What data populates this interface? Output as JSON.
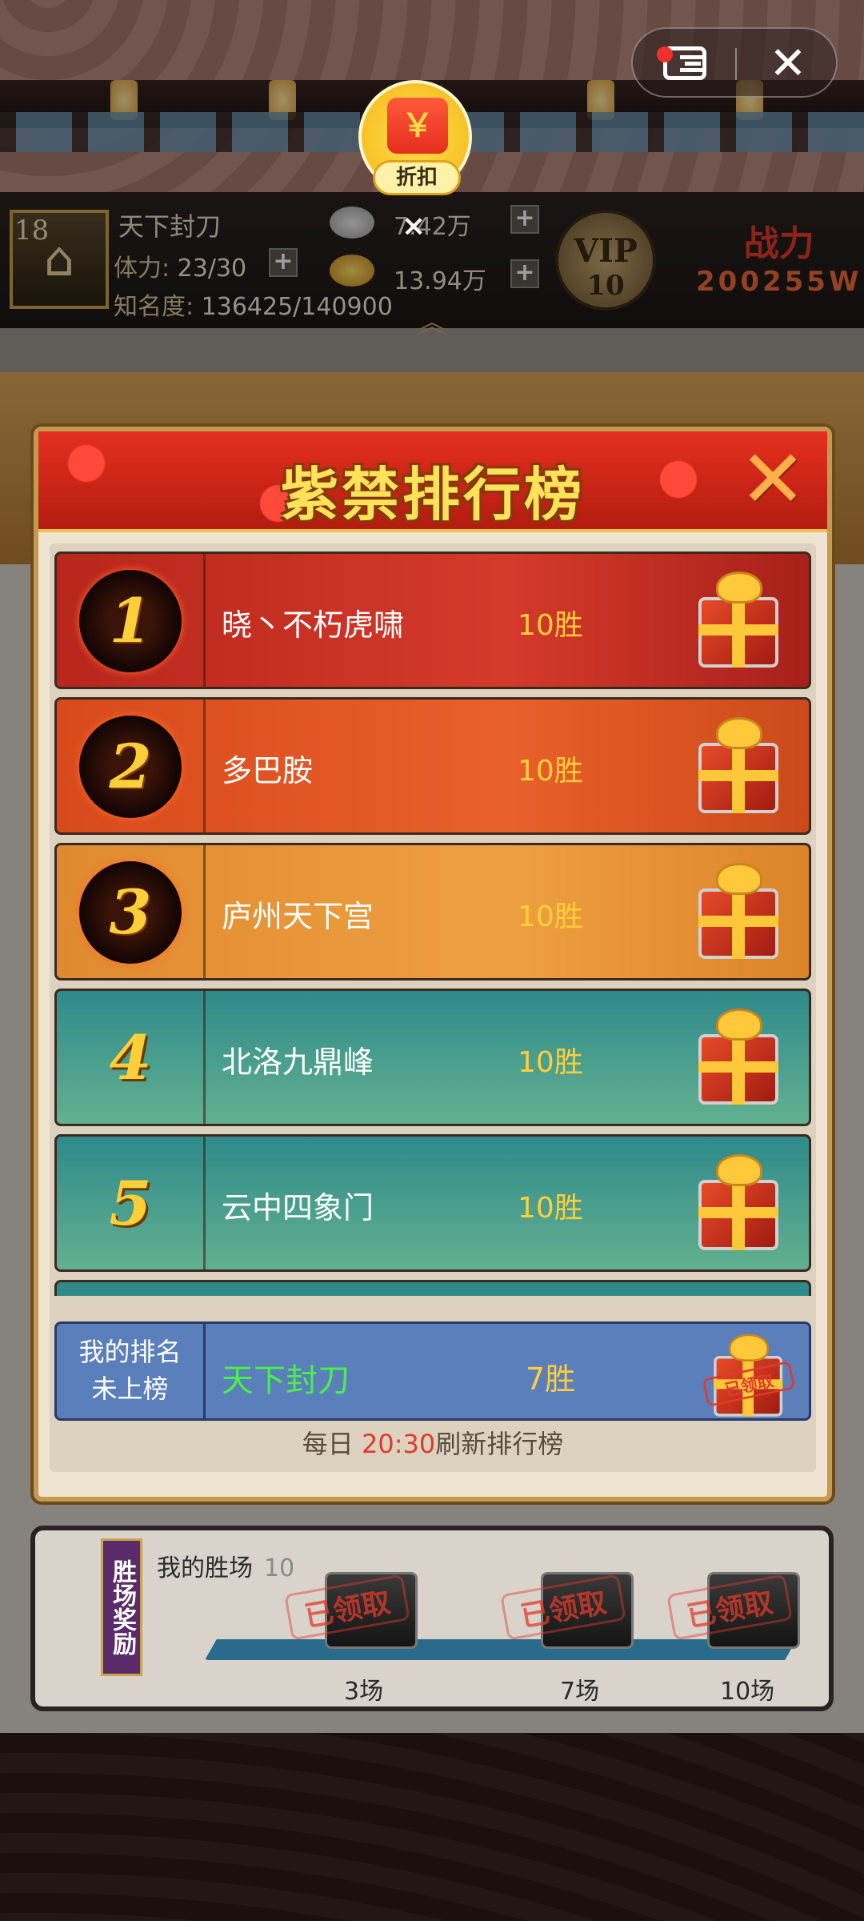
{
  "top_controls": {
    "menu_icon": "menu-icon",
    "close_icon": "close-icon",
    "close_symbol": "✕"
  },
  "discount_badge": {
    "label": "折扣",
    "icon_symbol": "￥",
    "close_symbol": "×"
  },
  "player": {
    "level": "18",
    "name": "天下封刀",
    "stamina_label": "体力:",
    "stamina_value": "23/30",
    "fame_label": "知名度:",
    "fame_value": "136425/140900",
    "silver": "7.42万",
    "gold": "13.94万",
    "vip_text": "VIP",
    "vip_level": "10",
    "power_label": "战力",
    "power_value": "200255W",
    "plus_symbol": "+",
    "expand_symbol": "︽"
  },
  "modal": {
    "title": "紫禁排行榜",
    "close_symbol": "✕",
    "rankings": [
      {
        "rank": "1",
        "name": "晓丶不朽虎啸",
        "wins": "10胜",
        "reward_icon": "gift-box-icon",
        "color": "#c8281e"
      },
      {
        "rank": "2",
        "name": "多巴胺",
        "wins": "10胜",
        "reward_icon": "gift-box-icon",
        "color": "#e0501e"
      },
      {
        "rank": "3",
        "name": "庐州天下宫",
        "wins": "10胜",
        "reward_icon": "gift-box-icon",
        "color": "#e88a2a"
      },
      {
        "rank": "4",
        "name": "北洛九鼎峰",
        "wins": "10胜",
        "reward_icon": "gift-box-icon",
        "color": "#3f9f96"
      },
      {
        "rank": "5",
        "name": "云中四象门",
        "wins": "10胜",
        "reward_icon": "gift-box-icon",
        "color": "#3f9f96"
      }
    ],
    "my_rank": {
      "label_line1": "我的排名",
      "label_line2": "未上榜",
      "name": "天下封刀",
      "wins": "7胜",
      "reward_stamp": "已领取"
    },
    "refresh_prefix": "每日 ",
    "refresh_time": "20:30",
    "refresh_suffix": "刷新排行榜"
  },
  "win_rewards": {
    "tag": "胜场奖励",
    "label": "我的胜场",
    "value": "10",
    "milestones": [
      {
        "label": "3场",
        "stamp": "已领取"
      },
      {
        "label": "7场",
        "stamp": "已领取"
      },
      {
        "label": "10场",
        "stamp": "已领取"
      }
    ]
  },
  "colors": {
    "accent_gold": "#ffcf3a",
    "header_red": "#d52818",
    "my_rank_blue": "#5a7fbb",
    "refresh_time_red": "#e23a2a"
  }
}
